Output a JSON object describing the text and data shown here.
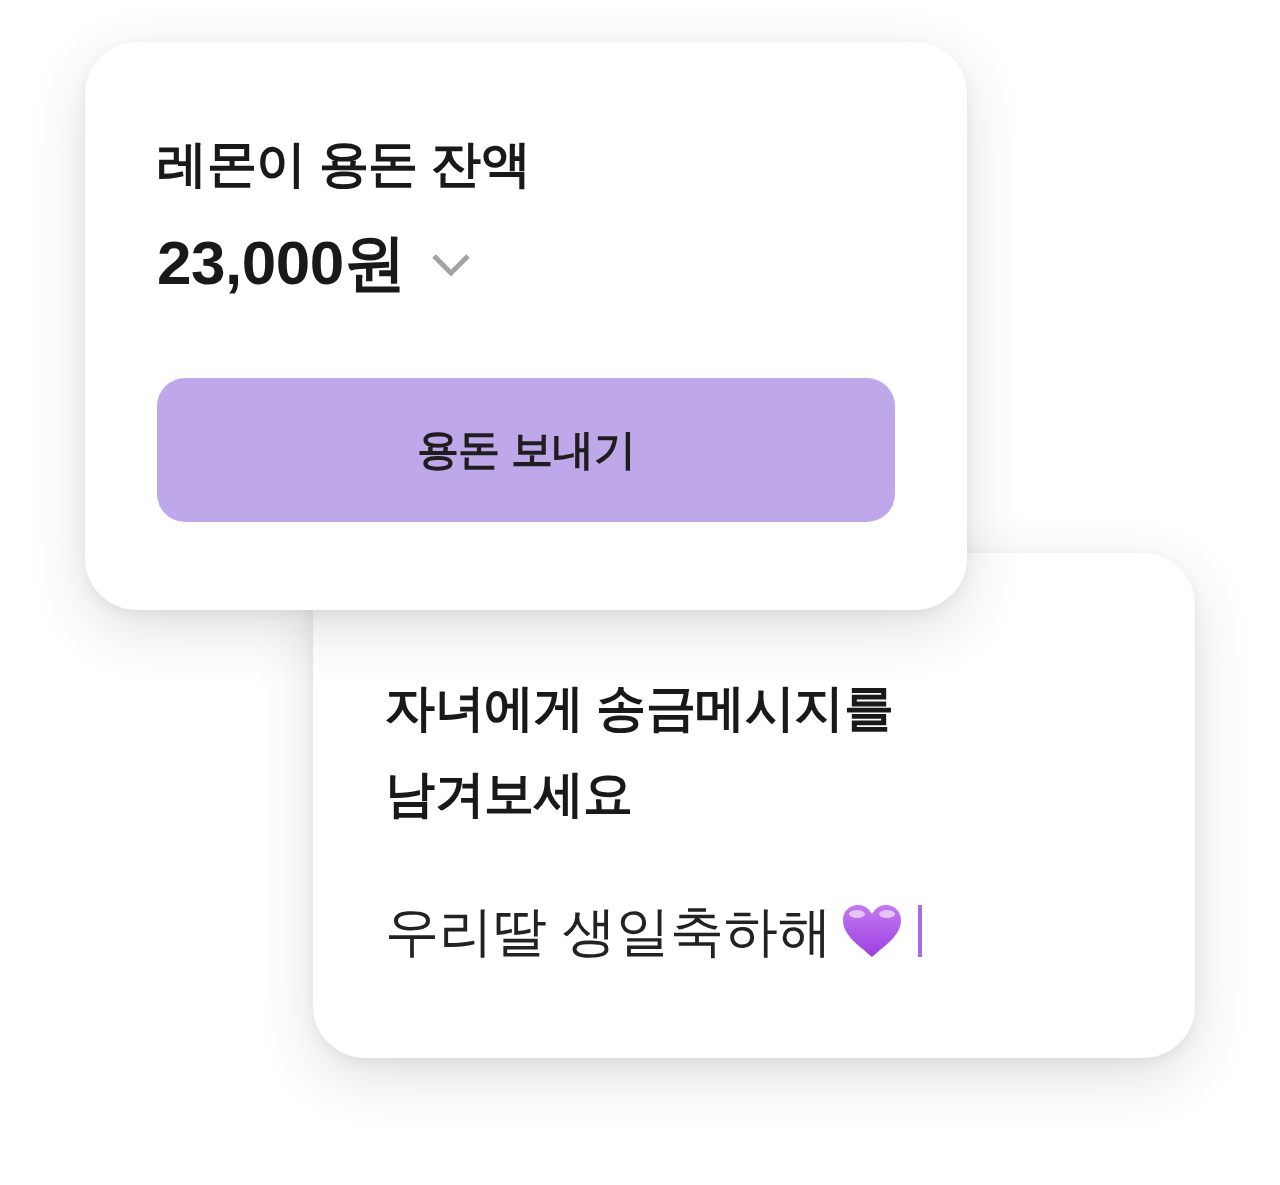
{
  "balance_card": {
    "title": "레몬이 용돈 잔액",
    "amount": "23,000원",
    "expanded": false,
    "button": "용돈 보내기"
  },
  "message_card": {
    "title": "자녀에게 송금메시지를 남겨보세요",
    "message": {
      "value": "우리딸 생일축하해",
      "focused": true
    }
  }
}
